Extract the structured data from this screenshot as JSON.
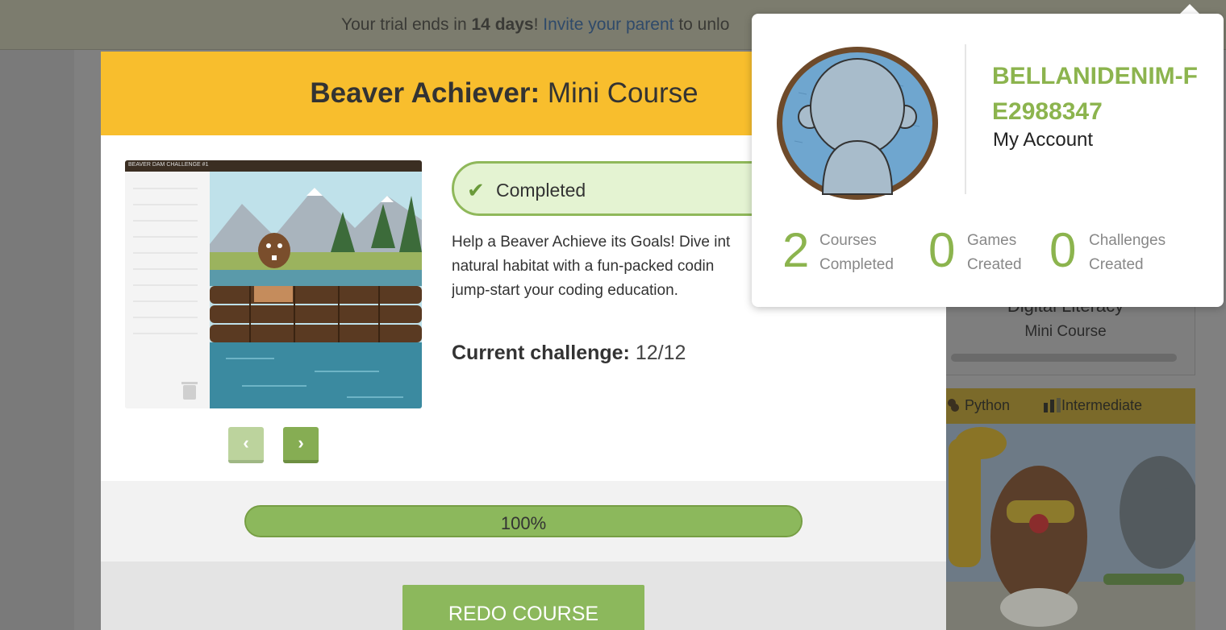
{
  "trial_bar": {
    "prefix": "Your trial ends in ",
    "days": "14 days",
    "middle": "! ",
    "link": "Invite your parent",
    "suffix": " to unlo"
  },
  "background": {
    "card1_title": "Digital Literacy",
    "card1_sub": "Mini Course",
    "card2_lang": "Python",
    "card2_level": "Intermediate"
  },
  "modal": {
    "title_bold": "Beaver Achiever:",
    "title_light": "Mini Course",
    "preview_caption": "BEAVER DAM CHALLENGE #1",
    "status": "Completed",
    "description": [
      "Help a Beaver Achieve its Goals! Dive int",
      "natural habitat with a fun-packed codin",
      "jump-start your coding education."
    ],
    "current_label": "Current challenge:",
    "current_value": "12/12",
    "prev_label": "‹",
    "next_label": "›",
    "progress_value": 1.0,
    "progress_text": "100%",
    "redo_label": "REDO COURSE"
  },
  "account": {
    "username": "BELLANIDENIM-FE2988347",
    "my_account": "My Account",
    "stats": [
      {
        "num": "2",
        "line1": "Courses",
        "line2": "Completed"
      },
      {
        "num": "0",
        "line1": "Games",
        "line2": "Created"
      },
      {
        "num": "0",
        "line1": "Challenges",
        "line2": "Created"
      }
    ]
  },
  "colors": {
    "accent_green": "#8cb44e",
    "header_yellow": "#f8be2d",
    "completed_bg": "#e4f3d2"
  }
}
